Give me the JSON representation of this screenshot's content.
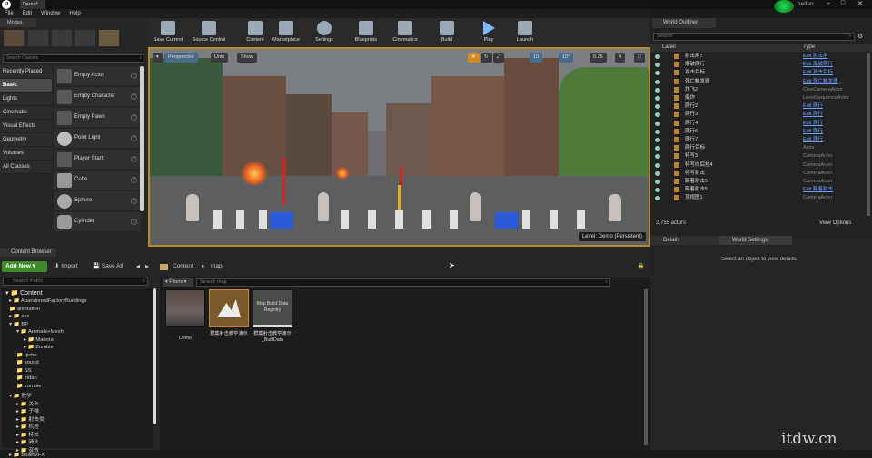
{
  "window": {
    "tab_title": "Demo*",
    "user": "beifen"
  },
  "menu": [
    "File",
    "Edit",
    "Window",
    "Help"
  ],
  "modes": {
    "title": "Modes",
    "search_placeholder": "Search Classes",
    "categories": [
      "Recently Placed",
      "Basic",
      "Lights",
      "Cinematic",
      "Visual Effects",
      "Geometry",
      "Volumes",
      "All Classes"
    ],
    "active_category": "Basic",
    "items": [
      "Empty Actor",
      "Empty Character",
      "Empty Pawn",
      "Point Light",
      "Player Start",
      "Cube",
      "Sphere",
      "Cylinder"
    ]
  },
  "toolbar": [
    "Save Current",
    "Source Control",
    "Content",
    "Marketplace",
    "Settings",
    "Blueprints",
    "Cinematics",
    "Build",
    "Play",
    "Launch"
  ],
  "viewport": {
    "perspective": "Perspective",
    "lighting": "Unlit",
    "show": "Show",
    "grid": "10",
    "rotation": "10°",
    "scale": "0.25",
    "camera_speed": "4",
    "level": "Level:  Demo (Persistent)"
  },
  "outliner": {
    "title": "World Outliner",
    "search_placeholder": "Search",
    "col_label": "Label",
    "col_type": "Type",
    "rows": [
      {
        "name": "射击用7",
        "type": "Edit 射击用",
        "link": true
      },
      {
        "name": "爆破爬行",
        "type": "Edit 爆破爬行",
        "link": true
      },
      {
        "name": "攻击目标",
        "type": "Edit 攻击目标",
        "link": true
      },
      {
        "name": "死亡触发器",
        "type": "Edit 死亡触发器",
        "link": true
      },
      {
        "name": "炸飞2",
        "type": "CineCameraActor",
        "link": false
      },
      {
        "name": "爆炸",
        "type": "LevelSequenceActor",
        "link": false
      },
      {
        "name": "爬行2",
        "type": "Edit 爬行",
        "link": true
      },
      {
        "name": "爬行3",
        "type": "Edit 爬行",
        "link": true
      },
      {
        "name": "爬行4",
        "type": "Edit 爬行",
        "link": true
      },
      {
        "name": "爬行6",
        "type": "Edit 爬行",
        "link": true
      },
      {
        "name": "爬行7",
        "type": "Edit 爬行",
        "link": true
      },
      {
        "name": "爬行目标",
        "type": "Actor",
        "link": false
      },
      {
        "name": "特写3",
        "type": "CameraActor",
        "link": false
      },
      {
        "name": "特写向后拉4",
        "type": "CameraActor",
        "link": false
      },
      {
        "name": "特写射击",
        "type": "CameraActor",
        "link": false
      },
      {
        "name": "踢着射击5",
        "type": "CameraActor",
        "link": false
      },
      {
        "name": "踢着射击5",
        "type": "Edit 踢着射击",
        "link": true
      },
      {
        "name": "顶视图1",
        "type": "CameraActor",
        "link": false
      }
    ],
    "actor_count": "2,755 actors",
    "view_options": "View Options"
  },
  "details": {
    "tab1": "Details",
    "tab2": "World Settings",
    "empty_msg": "Select an object to view details."
  },
  "content_browser": {
    "title": "Content Browser",
    "add_new": "Add New",
    "import": "Import",
    "save_all": "Save All",
    "path": [
      "Content",
      "map"
    ],
    "search_paths_placeholder": "Search Paths",
    "filters": "Filters",
    "search_placeholder": "Search map",
    "tree": [
      "Content",
      "AbandonedFactoryBuildings",
      "animation",
      "ass",
      "BP",
      "Animate+Mesh",
      "Material",
      "Zombie",
      "qiche",
      "sound",
      "SS",
      "zidan",
      "zombie",
      "教学",
      "关卡",
      "子弹",
      "射击类",
      "机枪",
      "特效",
      "骑头",
      "音效",
      "BulletVFX"
    ],
    "assets": [
      {
        "label": "Demo"
      },
      {
        "label": "群集射击教学演示"
      },
      {
        "label": "群集射击教学演示_BuiltData",
        "thumb": "Map Build Data Registry"
      }
    ]
  },
  "watermark": "itdw.cn"
}
